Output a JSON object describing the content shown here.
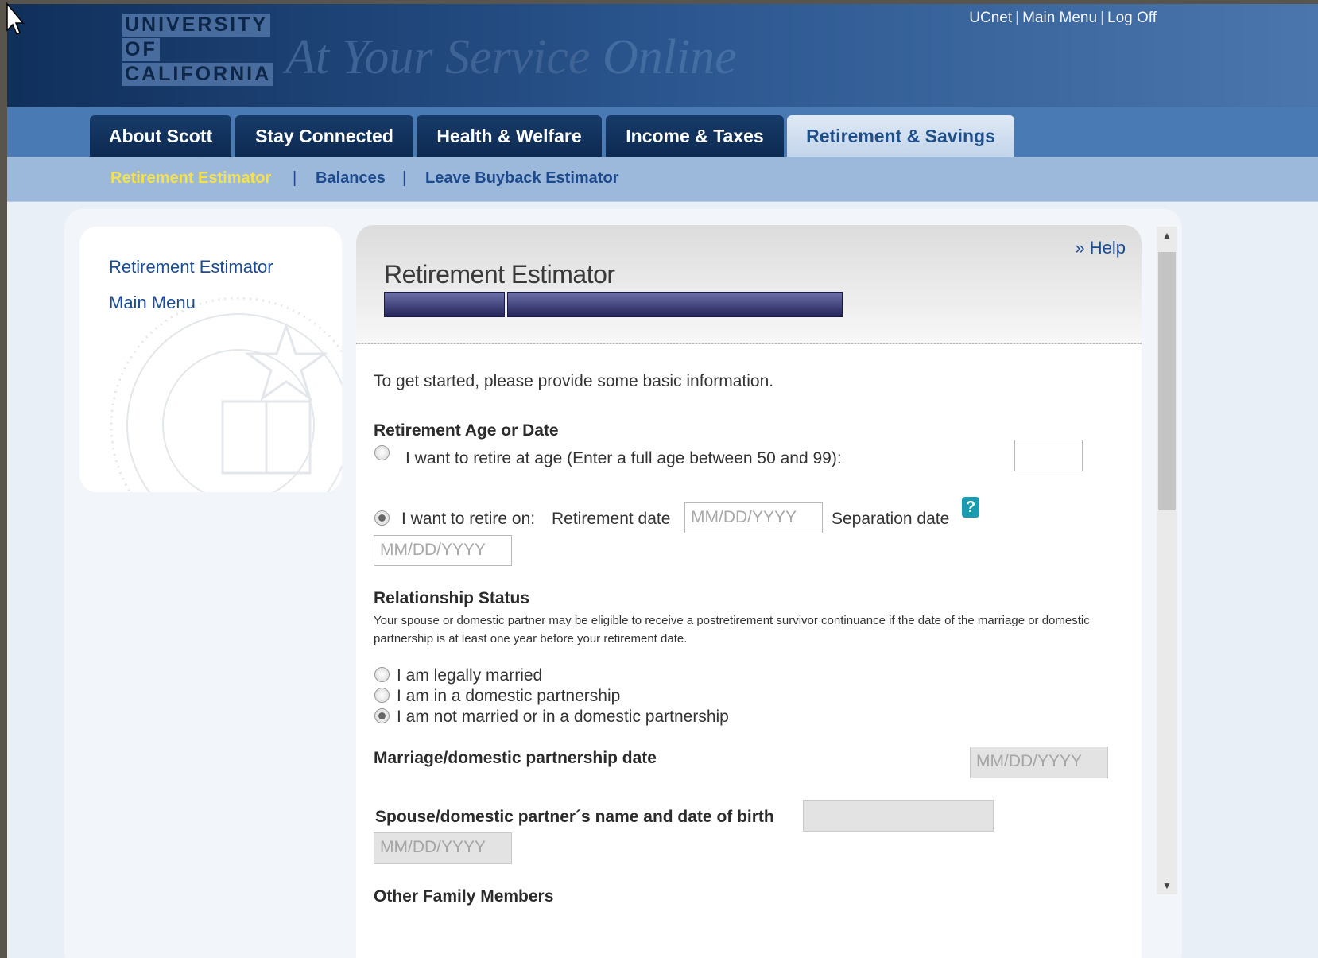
{
  "header": {
    "logo_lines": [
      "UNIVERSITY",
      "OF",
      "CALIFORNIA"
    ],
    "site_title_main": "At Your Service",
    "site_title_fade": "Online",
    "utility_nav": [
      "UCnet",
      "Main Menu",
      "Log Off"
    ],
    "utility_sep": "|"
  },
  "tabs": [
    {
      "label": "About Scott"
    },
    {
      "label": "Stay Connected"
    },
    {
      "label": "Health & Welfare"
    },
    {
      "label": "Income & Taxes"
    },
    {
      "label": "Retirement & Savings",
      "active": true
    }
  ],
  "subnav": {
    "items": [
      "Retirement Estimator",
      "Balances",
      "Leave Buyback Estimator"
    ],
    "sep": "|"
  },
  "sidebar": {
    "links": [
      "Retirement Estimator",
      "Main Menu"
    ]
  },
  "panel": {
    "help_link": "» Help",
    "title": "Retirement Estimator",
    "intro": "To get started, please provide some basic information.",
    "retirement_section": {
      "heading": "Retirement Age or Date",
      "option_age": "I want to retire at age (Enter a full age between 50 and 99):",
      "option_date_prefix": "I want to retire on:",
      "retirement_date_label": "Retirement date",
      "separation_date_label": "Separation date",
      "date_placeholder": "MM/DD/YYYY",
      "selected": "date"
    },
    "relationship_section": {
      "heading": "Relationship Status",
      "note": "Your spouse or domestic partner may be eligible to receive a postretirement survivor continuance if the date of the marriage or domestic partnership is at least one year before your retirement date.",
      "options": [
        "I am legally married",
        "I am in a domestic partnership",
        "I am not married or in a domestic partnership"
      ],
      "selected_index": 2
    },
    "marriage_date_label": "Marriage/domestic partnership date",
    "spouse_label": "Spouse/domestic partner´s name and date of birth",
    "other_family_heading": "Other Family Members",
    "help_icon_glyph": "?"
  },
  "colors": {
    "header_dark": "#102f5b",
    "tab_active_text": "#1f4f8a",
    "subnav_current": "#f5e24a",
    "link": "#1c4c96"
  }
}
